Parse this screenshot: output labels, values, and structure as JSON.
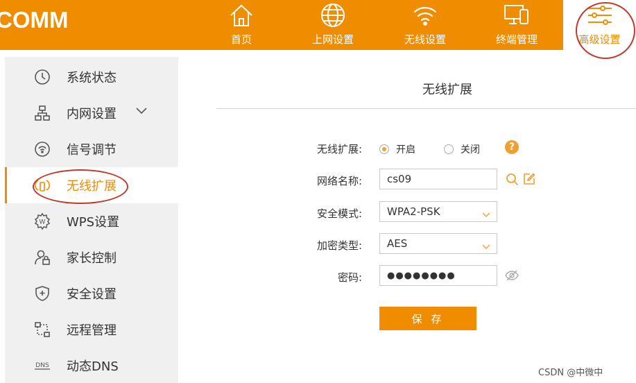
{
  "header": {
    "logo": "COMM",
    "nav": [
      {
        "label": "首页",
        "icon": "home-icon"
      },
      {
        "label": "上网设置",
        "icon": "globe-icon"
      },
      {
        "label": "无线设置",
        "icon": "wifi-icon"
      },
      {
        "label": "终端管理",
        "icon": "devices-icon"
      },
      {
        "label": "高级设置",
        "icon": "sliders-icon",
        "active": true
      }
    ]
  },
  "sidebar": {
    "items": [
      {
        "label": "系统状态",
        "icon": "clock-icon"
      },
      {
        "label": "内网设置",
        "icon": "network-icon",
        "has_submenu": true
      },
      {
        "label": "信号调节",
        "icon": "signal-icon"
      },
      {
        "label": "无线扩展",
        "icon": "wireless-extend-icon",
        "active": true
      },
      {
        "label": "WPS设置",
        "icon": "wps-gear-icon"
      },
      {
        "label": "家长控制",
        "icon": "parental-lock-icon"
      },
      {
        "label": "安全设置",
        "icon": "shield-icon"
      },
      {
        "label": "远程管理",
        "icon": "remote-icon"
      },
      {
        "label": "动态DNS",
        "icon": "dns-icon"
      }
    ]
  },
  "main": {
    "title": "无线扩展",
    "form": {
      "extend_label": "无线扩展:",
      "extend_on": "开启",
      "extend_off": "关闭",
      "extend_selected": "开启",
      "help": "?",
      "ssid_label": "网络名称:",
      "ssid_value": "cs09",
      "security_label": "安全模式:",
      "security_value": "WPA2-PSK",
      "encryption_label": "加密类型:",
      "encryption_value": "AES",
      "password_label": "密码:",
      "password_value": "●●●●●●●●"
    },
    "save_label": "保 存"
  },
  "watermark": "CSDN @中微中",
  "colors": {
    "accent": "#f08c00",
    "sidebar_bg": "#f0f0f0",
    "annotation": "#c0392b"
  }
}
